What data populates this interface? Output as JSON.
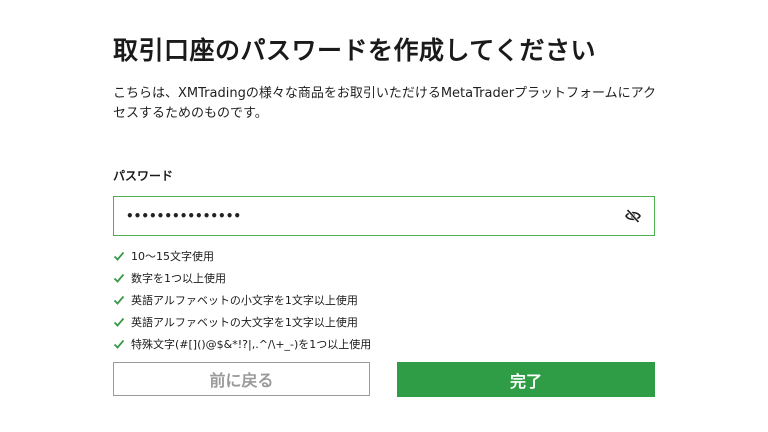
{
  "title": "取引口座のパスワードを作成してください",
  "description": "こちらは、XMTradingの様々な商品をお取引いただけるMetaTraderプラットフォームにアクセスするためのものです。",
  "password": {
    "label": "パスワード",
    "masked_value": "•••••••••••••••",
    "toggle_icon": "eye-slash-icon"
  },
  "rules": [
    {
      "text": "10〜15文字使用",
      "met": true
    },
    {
      "text": "数字を1つ以上使用",
      "met": true
    },
    {
      "text": "英語アルファベットの小文字を1文字以上使用",
      "met": true
    },
    {
      "text": "英語アルファベットの大文字を1文字以上使用",
      "met": true
    },
    {
      "text": "特殊文字(#[]()@$&*!?|,.^/\\+_-)を1つ以上使用",
      "met": true
    }
  ],
  "buttons": {
    "back_label": "前に戻る",
    "done_label": "完了"
  },
  "colors": {
    "accent_green": "#2e9d45",
    "check_green": "#3a9a4a",
    "input_border": "#4caf50",
    "back_text": "#9a9a9a"
  }
}
